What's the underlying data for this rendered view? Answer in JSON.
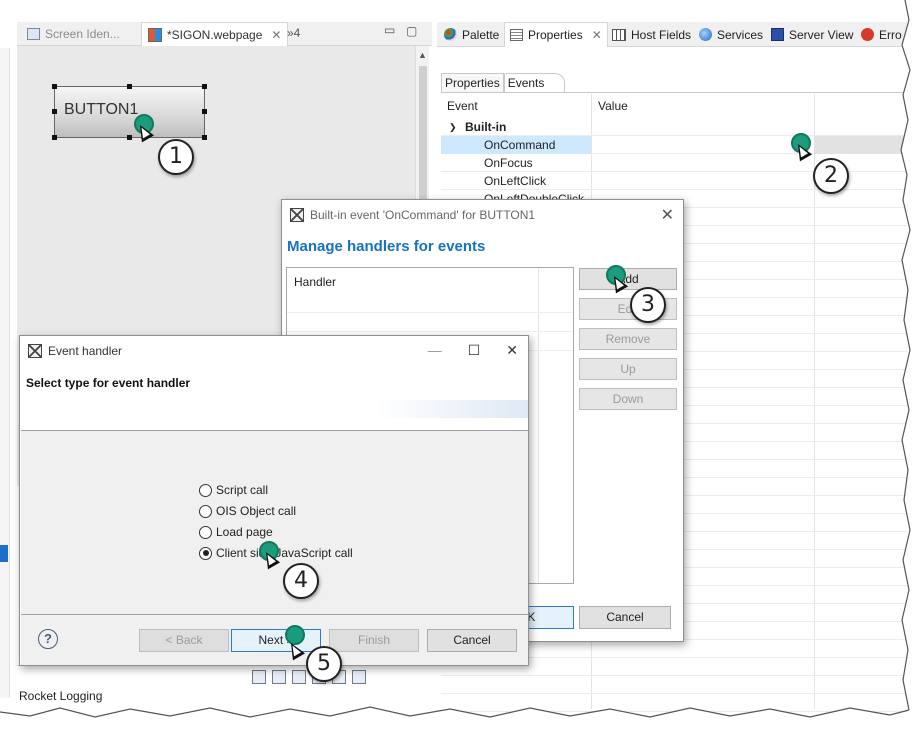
{
  "editor": {
    "tabs": [
      {
        "label": "Screen Iden...",
        "icon": "screen-icon",
        "state": "inactive"
      },
      {
        "label": "*SIGON.webpage",
        "icon": "webpage-icon",
        "state": "active"
      }
    ],
    "overflow_label": "»4",
    "canvas_button_label": "BUTTON1"
  },
  "properties_panel": {
    "tabs": [
      {
        "label": "Palette",
        "icon": "palette-icon"
      },
      {
        "label": "Properties",
        "icon": "properties-icon"
      },
      {
        "label": "Host Fields",
        "icon": "host-fields-icon"
      },
      {
        "label": "Services",
        "icon": "services-icon"
      },
      {
        "label": "Server View",
        "icon": "server-view-icon"
      },
      {
        "label": "Erro",
        "icon": "error-log-icon"
      }
    ],
    "sub_tabs": [
      "Properties",
      "Events"
    ],
    "columns": {
      "event": "Event",
      "value": "Value"
    },
    "group_label": "Built-in",
    "rows": [
      "OnCommand",
      "OnFocus",
      "OnLeftClick",
      "OnLeftDoubleClick"
    ]
  },
  "handlers_dialog": {
    "title": "Built-in event 'OnCommand' for BUTTON1",
    "heading": "Manage handlers for events",
    "list_header": "Handler",
    "buttons": {
      "add": "Add",
      "edit": "Edit",
      "remove": "Remove",
      "up": "Up",
      "down": "Down"
    },
    "ok_label": "OK",
    "cancel_label": "Cancel"
  },
  "event_handler_dialog": {
    "title": "Event handler",
    "heading": "Select type for event handler",
    "options": [
      "Script call",
      "OIS Object call",
      "Load page",
      "Client side JavaScript call"
    ],
    "selected_option": "Client side JavaScript call",
    "buttons": {
      "back": "< Back",
      "next": "Next >",
      "finish": "Finish",
      "cancel": "Cancel"
    }
  },
  "bottom_panel": {
    "label": "Rocket Logging"
  },
  "callouts": [
    "1",
    "2",
    "3",
    "4",
    "5"
  ],
  "colors": {
    "accent": "#1572c5",
    "marker": "#1a9c7d",
    "selection": "#cde8ff"
  }
}
